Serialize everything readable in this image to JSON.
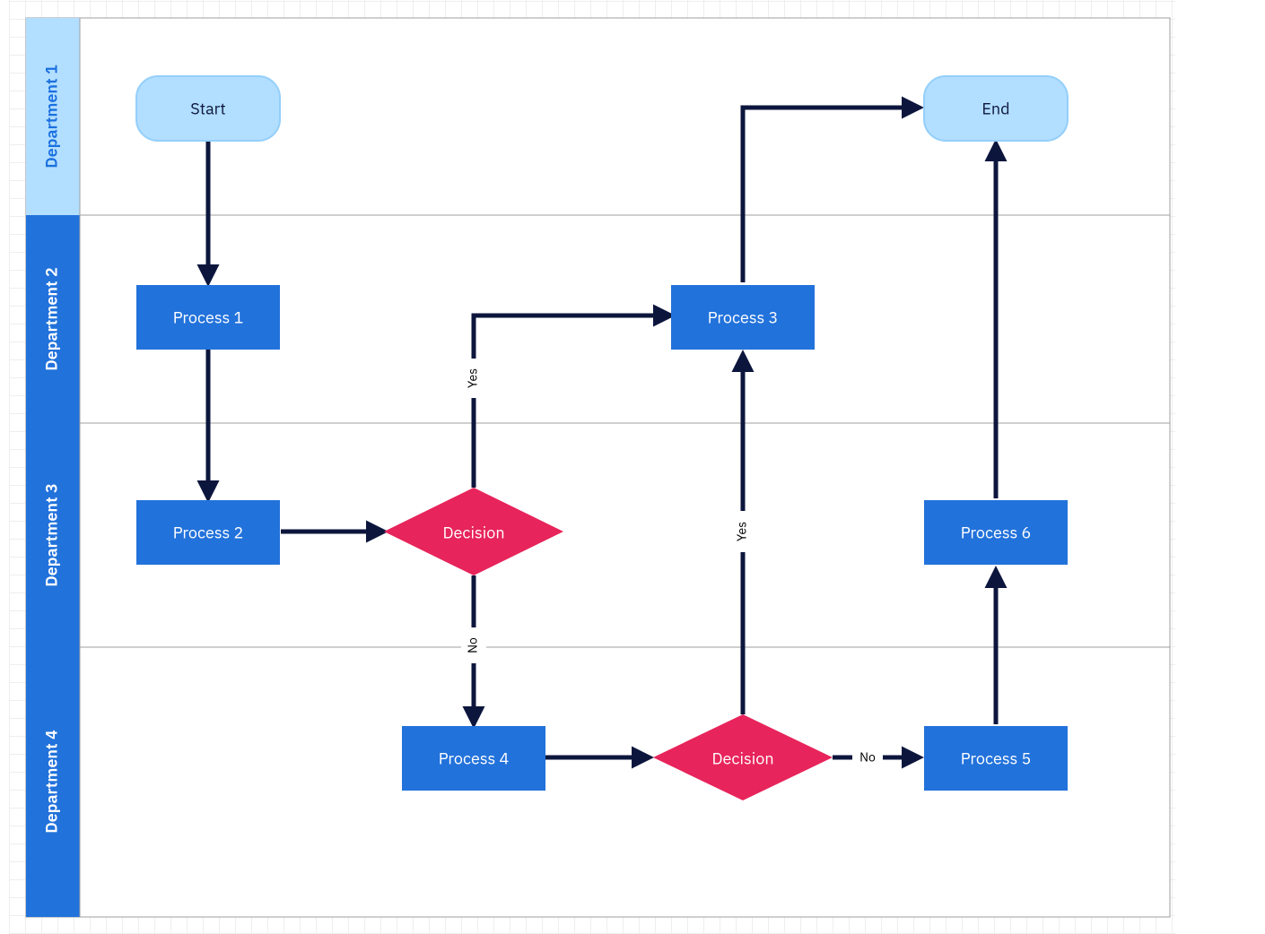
{
  "lanes": [
    {
      "id": "lane1",
      "label": "Department 1",
      "header_fill": "#b2deff",
      "header_text": "#1a70e0"
    },
    {
      "id": "lane2",
      "label": "Department 2",
      "header_fill": "#2272db",
      "header_text": "#ffffff"
    },
    {
      "id": "lane3",
      "label": "Department 3",
      "header_fill": "#2272db",
      "header_text": "#ffffff"
    },
    {
      "id": "lane4",
      "label": "Department 4",
      "header_fill": "#2272db",
      "header_text": "#ffffff"
    }
  ],
  "nodes": {
    "start": {
      "label": "Start",
      "type": "terminator",
      "fill": "#b2deff",
      "stroke": "#94cffb",
      "text": "#0c163d"
    },
    "end": {
      "label": "End",
      "type": "terminator",
      "fill": "#b2deff",
      "stroke": "#94cffb",
      "text": "#0c163d"
    },
    "p1": {
      "label": "Process 1",
      "type": "process",
      "fill": "#2272db",
      "text": "#ffffff"
    },
    "p2": {
      "label": "Process 2",
      "type": "process",
      "fill": "#2272db",
      "text": "#ffffff"
    },
    "p3": {
      "label": "Process 3",
      "type": "process",
      "fill": "#2272db",
      "text": "#ffffff"
    },
    "p4": {
      "label": "Process 4",
      "type": "process",
      "fill": "#2272db",
      "text": "#ffffff"
    },
    "p5": {
      "label": "Process 5",
      "type": "process",
      "fill": "#2272db",
      "text": "#ffffff"
    },
    "p6": {
      "label": "Process 6",
      "type": "process",
      "fill": "#2272db",
      "text": "#ffffff"
    },
    "d1": {
      "label": "Decision",
      "type": "decision",
      "fill": "#e7245b",
      "text": "#ffffff"
    },
    "d2": {
      "label": "Decision",
      "type": "decision",
      "fill": "#e7245b",
      "text": "#ffffff"
    }
  },
  "edge_labels": {
    "d1_yes": "Yes",
    "d1_no": "No",
    "d2_yes": "Yes",
    "d2_no": "No"
  }
}
